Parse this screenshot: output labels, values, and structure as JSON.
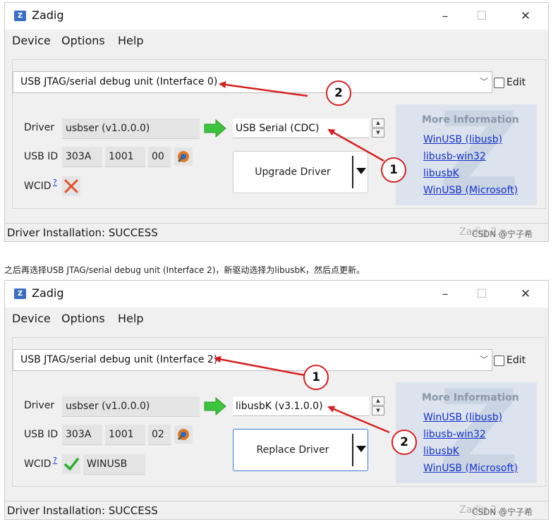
{
  "caption": "之后再选择USB JTAG/serial debug unit (Interface 2)，新驱动选择为libusbK，然后点更新。",
  "windows": [
    {
      "title": "Zadig",
      "app_icon_letter": "Z",
      "menu": [
        "Device",
        "Options",
        "Help"
      ],
      "device_combo": "USB JTAG/serial debug unit (Interface 0)",
      "edit_label": "Edit",
      "labels": {
        "driver": "Driver",
        "usb_id": "USB ID",
        "wcid": "WCID",
        "wcid_help": "?"
      },
      "current_driver": "usbser (v1.0.0.0)",
      "usb_id": [
        "303A",
        "1001",
        "00"
      ],
      "target_driver": "USB Serial (CDC)",
      "action_button": "Upgrade Driver",
      "wcid_state": "cross-icon",
      "wcid_value": "",
      "info_title": "More Information",
      "info_links": [
        "WinUSB (libusb)",
        "libusb-win32",
        "libusbK",
        "WinUSB (Microsoft)"
      ],
      "status": "Driver Installation: SUCCESS",
      "status_watermark": "Zadig 2.x",
      "csdn_mark": "CSDN @宁子希",
      "callouts": [
        "2",
        "1"
      ]
    },
    {
      "title": "Zadig",
      "app_icon_letter": "Z",
      "menu": [
        "Device",
        "Options",
        "Help"
      ],
      "device_combo": "USB JTAG/serial debug unit (Interface 2)",
      "edit_label": "Edit",
      "labels": {
        "driver": "Driver",
        "usb_id": "USB ID",
        "wcid": "WCID",
        "wcid_help": "?"
      },
      "current_driver": "usbser (v1.0.0.0)",
      "usb_id": [
        "303A",
        "1001",
        "02"
      ],
      "target_driver": "libusbK (v3.1.0.0)",
      "action_button": "Replace Driver",
      "wcid_state": "check-icon",
      "wcid_value": "WINUSB",
      "info_title": "More Information",
      "info_links": [
        "WinUSB (libusb)",
        "libusb-win32",
        "libusbK",
        "WinUSB (Microsoft)"
      ],
      "status": "Driver Installation: SUCCESS",
      "status_watermark": "Zadig 2.x",
      "csdn_mark": "CSDN @宁子希",
      "callouts": [
        "1",
        "2"
      ]
    }
  ],
  "colors": {
    "callout_red": "#d62020",
    "link_blue": "#1432c8",
    "green_arrow": "#3cc43c"
  }
}
